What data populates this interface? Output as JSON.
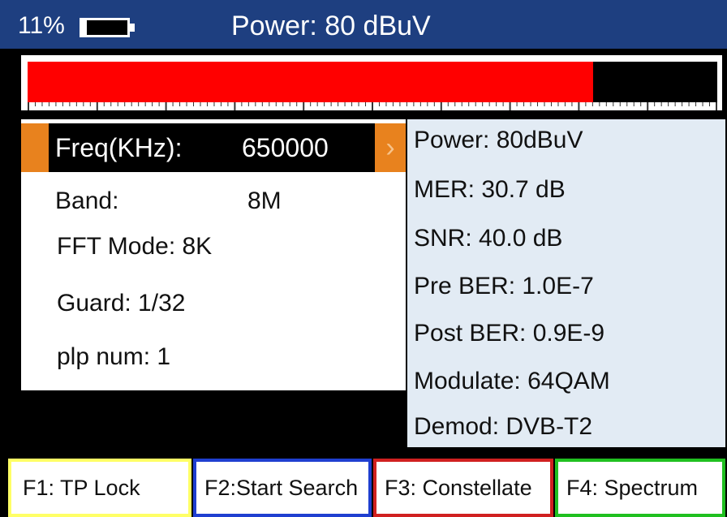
{
  "header": {
    "battery_percent": "11%",
    "battery_level": 0.11,
    "title": "Power: 80 dBuV",
    "background_color": "#1e3f80"
  },
  "meter": {
    "level": 0.82,
    "fill_color": "#ff0000"
  },
  "settings": {
    "freq_label": "Freq(KHz):",
    "freq_value": "650000",
    "arrow": "›",
    "band": "Band:",
    "band_value": "8M",
    "fft_mode": "FFT Mode: 8K",
    "guard": "Guard: 1/32",
    "plp_num": "plp num: 1",
    "accent_color": "#e8821e"
  },
  "status": {
    "power": "Power: 80dBuV",
    "mer": "MER: 30.7 dB",
    "snr": "SNR: 40.0 dB",
    "pre_ber": "Pre BER: 1.0E-7",
    "post_ber": "Post BER: 0.9E-9",
    "modulate": "Modulate: 64QAM",
    "demod": "Demod: DVB-T2"
  },
  "function_keys": [
    {
      "label": "F1:   TP Lock",
      "color": "#ffff66"
    },
    {
      "label": "F2:Start Search",
      "color": "#1f3fd0"
    },
    {
      "label": "F3: Constellate",
      "color": "#d02020"
    },
    {
      "label": "F4:  Spectrum",
      "color": "#20c020"
    }
  ]
}
